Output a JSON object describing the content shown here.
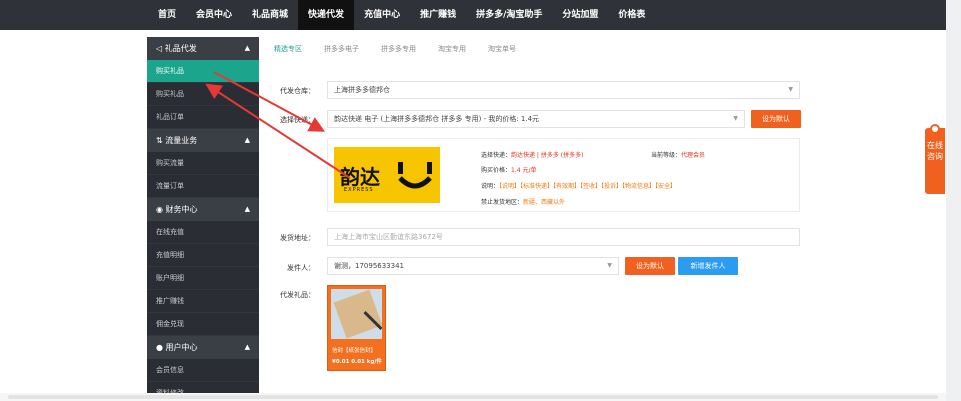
{
  "nav": {
    "items": [
      "首页",
      "会员中心",
      "礼品商城",
      "快递代发",
      "充值中心",
      "推广赚钱",
      "拼多多/淘宝助手",
      "分站加盟",
      "价格表"
    ],
    "active_index": 3
  },
  "sidebar": {
    "groups": [
      {
        "title": "礼品代发",
        "icon": "send-icon",
        "items": [
          "购买礼品",
          "购买礼品",
          "礼品订单"
        ]
      },
      {
        "title": "流量业务",
        "icon": "traffic-icon",
        "items": [
          "购买流量",
          "流量订单"
        ]
      },
      {
        "title": "财务中心",
        "icon": "finance-icon",
        "items": [
          "在线充值",
          "充值明细",
          "账户明细",
          "推广赚钱",
          "佣金兑现"
        ]
      },
      {
        "title": "用户中心",
        "icon": "user-icon",
        "items": [
          "会员信息",
          "资料修改"
        ]
      }
    ],
    "active_item": "购买礼品"
  },
  "tabs": {
    "items": [
      "精选专区",
      "拼多多电子",
      "拼多多专用",
      "淘宝专用",
      "淘宝单号"
    ],
    "active_index": 0
  },
  "form": {
    "warehouse_label": "代发仓库：",
    "warehouse_value": "上海拼多多德邦仓",
    "courier_label": "选择快递：",
    "courier_value": "韵达快递 电子 (上海拼多多德邦仓 拼多多 专用) - 我的价格: 1.4元",
    "set_default_label": "设为默认",
    "address_label": "发货地址：",
    "address_value": "上海上海市宝山区勤谊东路3672号",
    "sender_label": "发件人：",
    "sender_value": "谢测，17095633341",
    "set_default_label_2": "设为默认",
    "add_sender_label": "新增发件人",
    "gift_label": "代发礼品："
  },
  "courier": {
    "logo_text": "韵达",
    "logo_sub": "EXPRESS",
    "current_label": "选择快递：",
    "current_value": "韵达快递 | 拼多多 (拼多多)",
    "level_label": "当前等级：",
    "level_value": "代理会员",
    "price_label": "购买价格：",
    "price_value": "1.4 元/单",
    "note_label": "说明：",
    "note_value": "【说明】【标准快递】【有效期】【签收】【投诉】【物流信息】【安全】",
    "forbid_label": "禁止发货地区：",
    "forbid_value": "新疆、西藏以外"
  },
  "gift": {
    "name": "信封【纸张信封】",
    "price": "¥0.01  0.01 kg/件"
  },
  "consult": {
    "text": "在线咨询"
  },
  "colors": {
    "accent": "#1aa58c",
    "nav_bg": "#2f3238",
    "sidebar_bg": "#2a2d33",
    "orange": "#f0601f",
    "blue": "#2b9cf2",
    "arrow": "#e53935"
  }
}
